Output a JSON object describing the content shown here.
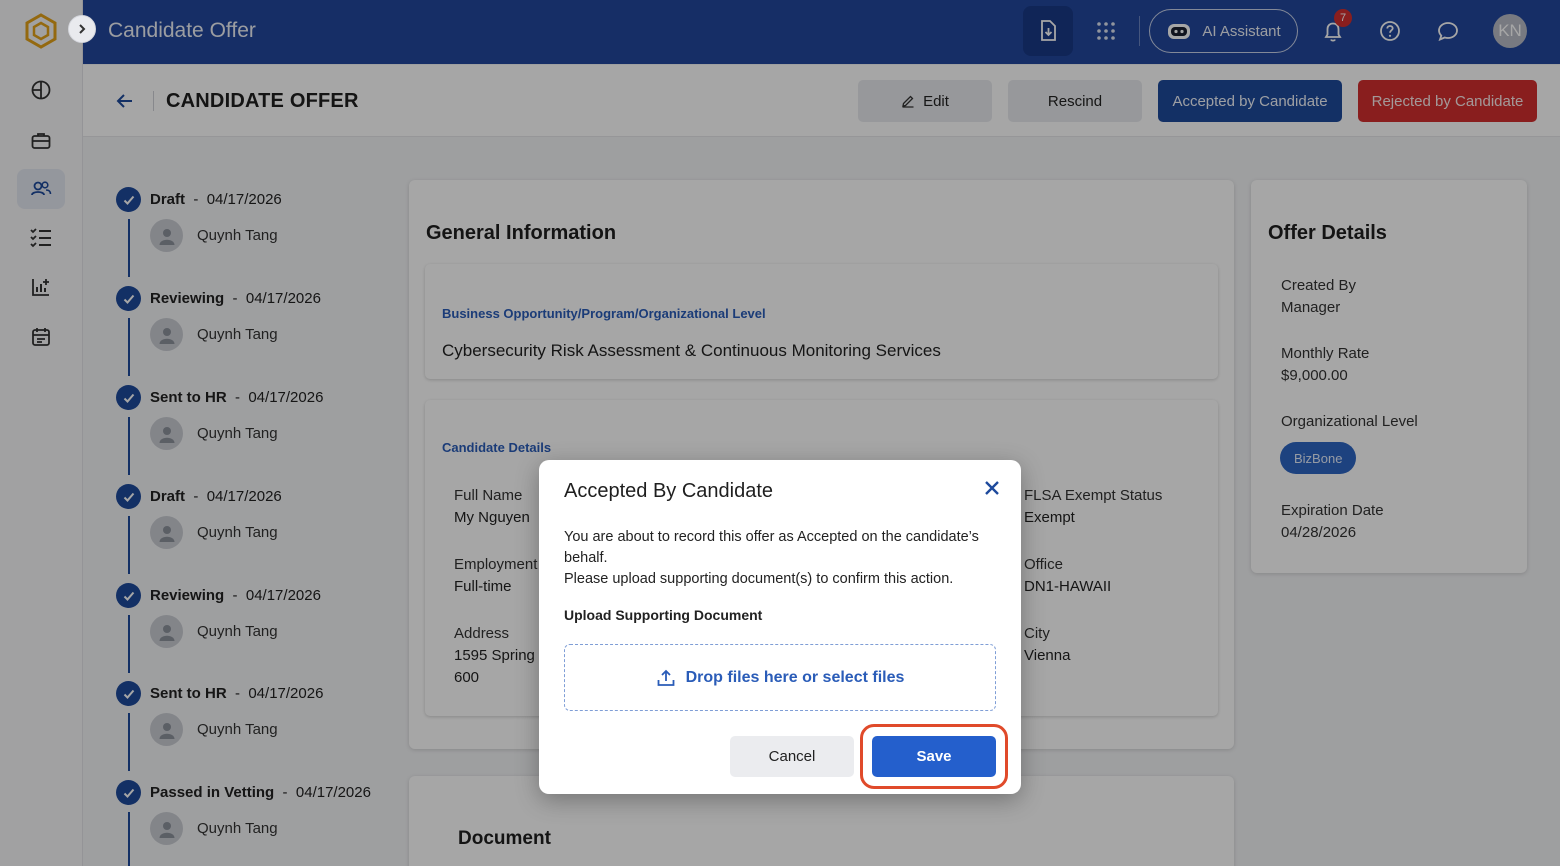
{
  "header": {
    "title": "Candidate Offer",
    "ai_label": "AI Assistant",
    "notif_count": "7",
    "avatar_initials": "KN"
  },
  "page": {
    "title": "CANDIDATE OFFER",
    "actions": {
      "edit": "Edit",
      "rescind": "Rescind",
      "accepted": "Accepted by Candidate",
      "rejected": "Rejected by Candidate"
    }
  },
  "timeline": [
    {
      "status": "Draft",
      "date": "04/17/2026",
      "user": "Quynh Tang"
    },
    {
      "status": "Reviewing",
      "date": "04/17/2026",
      "user": "Quynh Tang"
    },
    {
      "status": "Sent to HR",
      "date": "04/17/2026",
      "user": "Quynh Tang"
    },
    {
      "status": "Draft",
      "date": "04/17/2026",
      "user": "Quynh Tang"
    },
    {
      "status": "Reviewing",
      "date": "04/17/2026",
      "user": "Quynh Tang"
    },
    {
      "status": "Sent to HR",
      "date": "04/17/2026",
      "user": "Quynh Tang"
    },
    {
      "status": "Passed in Vetting",
      "date": "04/17/2026",
      "user": "Quynh Tang"
    }
  ],
  "general": {
    "title": "General Information",
    "biz_label": "Business Opportunity/Program/Organizational Level",
    "biz_value": "Cybersecurity Risk Assessment & Continuous Monitoring Services",
    "candidate_label": "Candidate Details",
    "full_name_label": "Full Name",
    "full_name": "My Nguyen",
    "employment_label": "Employment",
    "employment": "Full-time",
    "address_label": "Address",
    "address_line1": "1595 Spring I",
    "address_line2": "600",
    "flsa_label": "FLSA Exempt Status",
    "flsa": "Exempt",
    "office_label": "Office",
    "office": "DN1-HAWAII",
    "city_label": "City",
    "city": "Vienna"
  },
  "offer": {
    "title": "Offer Details",
    "created_by_label": "Created By",
    "created_by": "Manager",
    "monthly_rate_label": "Monthly Rate",
    "monthly_rate": "$9,000.00",
    "org_level_label": "Organizational Level",
    "org_level": "BizBone",
    "expiration_label": "Expiration Date",
    "expiration": "04/28/2026"
  },
  "document": {
    "title": "Document"
  },
  "modal": {
    "title": "Accepted By Candidate",
    "message_line1": "You are about to record this offer as Accepted on the candidate’s behalf.",
    "message_line2": "Please upload supporting document(s) to confirm this action.",
    "upload_label": "Upload Supporting Document",
    "drop_text": "Drop files here or select files",
    "cancel": "Cancel",
    "save": "Save"
  },
  "colors": {
    "header_bg": "#22479d",
    "primary": "#1e4a9c",
    "danger": "#d32f2f",
    "link": "#2a5cb8",
    "highlight": "#e04a2a"
  }
}
